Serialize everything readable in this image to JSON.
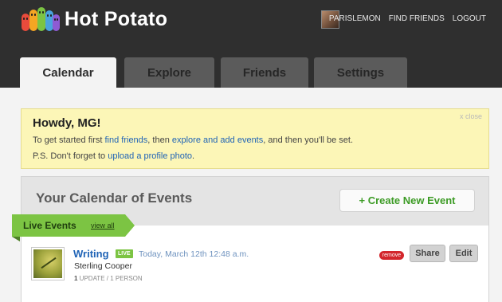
{
  "app": {
    "name": "Hot Potato"
  },
  "colors": {
    "header_bg": "#2f2f2f",
    "accent_green": "#7cc443",
    "link_blue": "#1f63b6",
    "welcome_bg": "#fcf6b7",
    "remove_red": "#d3262c",
    "logo_pills": [
      "#e94b3c",
      "#f5a623",
      "#7cc443",
      "#4aa3df",
      "#8e5bd4"
    ]
  },
  "header": {
    "username": "PARISLEMON",
    "find_friends": "FIND FRIENDS",
    "logout": "LOGOUT"
  },
  "tabs": [
    {
      "label": "Calendar",
      "active": true
    },
    {
      "label": "Explore",
      "active": false
    },
    {
      "label": "Friends",
      "active": false
    },
    {
      "label": "Settings",
      "active": false
    }
  ],
  "welcome": {
    "heading": "Howdy, MG!",
    "close": "x close",
    "line1_pre": "To get started first ",
    "line1_link1": "find friends",
    "line1_mid": ", then ",
    "line1_link2": "explore and add events",
    "line1_post": ", and then you'll be set.",
    "line2_pre": "P.S. Don't forget to ",
    "line2_link": "upload a profile photo",
    "line2_post": "."
  },
  "calendar": {
    "title": "Your Calendar of Events",
    "create_button": "+ Create New Event",
    "section_label": "Live Events",
    "view_all": "view all"
  },
  "events": [
    {
      "title": "Writing",
      "badge": "LIVE",
      "time": "Today, March 12th 12:48 a.m.",
      "company": "Sterling Cooper",
      "updates_count": "1",
      "meta_rest": " UPDATE / 1 PERSON",
      "remove": "remove",
      "share": "Share",
      "edit": "Edit"
    }
  ]
}
